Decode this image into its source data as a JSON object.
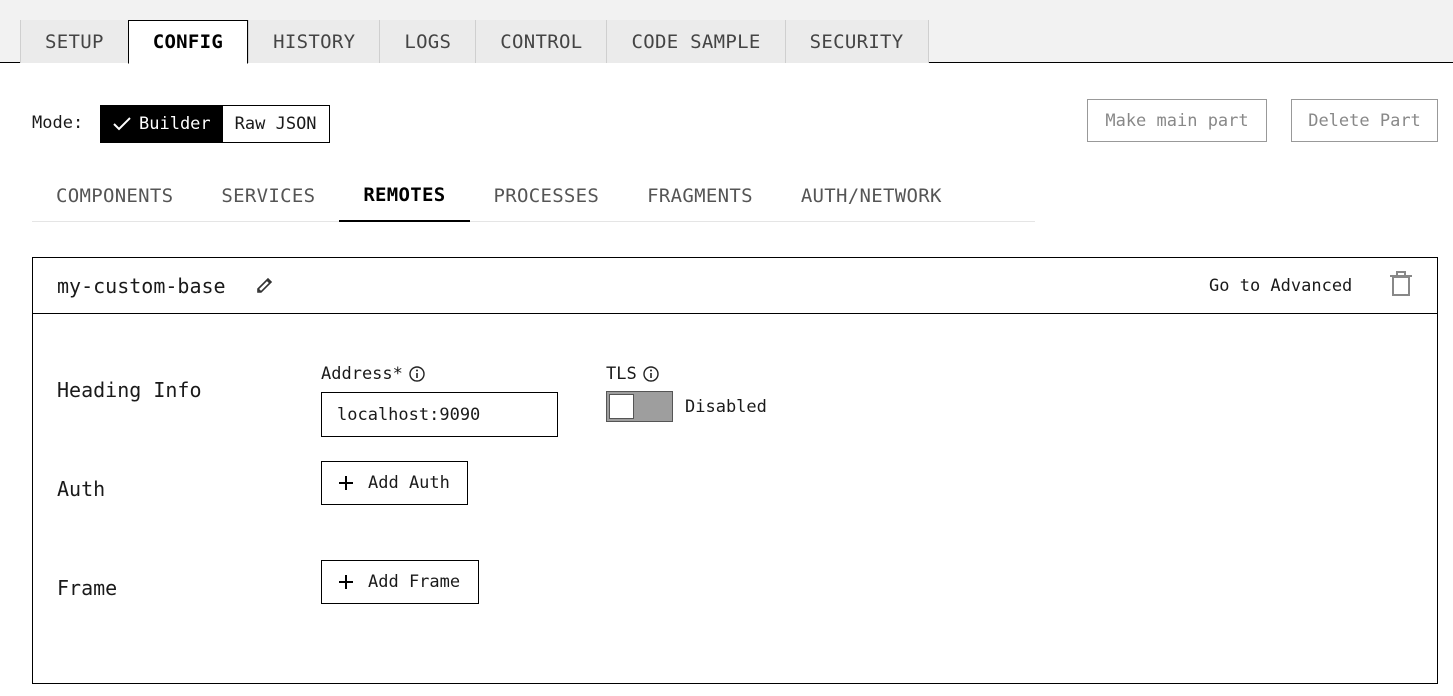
{
  "top_tabs": [
    {
      "label": "SETUP"
    },
    {
      "label": "CONFIG"
    },
    {
      "label": "HISTORY"
    },
    {
      "label": "LOGS"
    },
    {
      "label": "CONTROL"
    },
    {
      "label": "CODE SAMPLE"
    },
    {
      "label": "SECURITY"
    }
  ],
  "top_tabs_active": "CONFIG",
  "mode": {
    "label": "Mode:",
    "options": [
      "Builder",
      "Raw JSON"
    ],
    "selected": "Builder"
  },
  "actions": {
    "make_main": "Make main part",
    "delete_part": "Delete Part"
  },
  "sub_tabs": [
    {
      "label": "COMPONENTS"
    },
    {
      "label": "SERVICES"
    },
    {
      "label": "REMOTES"
    },
    {
      "label": "PROCESSES"
    },
    {
      "label": "FRAGMENTS"
    },
    {
      "label": "AUTH/NETWORK"
    }
  ],
  "sub_tabs_active": "REMOTES",
  "card": {
    "title": "my-custom-base",
    "advanced_link": "Go to Advanced",
    "rows": {
      "heading": "Heading Info",
      "auth": "Auth",
      "frame": "Frame"
    },
    "address": {
      "label": "Address*",
      "value": "localhost:9090"
    },
    "tls": {
      "label": "TLS",
      "state": "Disabled"
    },
    "add_auth": "Add Auth",
    "add_frame": "Add Frame"
  },
  "icons": {
    "check": "check-icon",
    "edit": "pencil-icon",
    "trash": "trash-icon",
    "info": "info-icon",
    "plus": "plus-icon"
  }
}
